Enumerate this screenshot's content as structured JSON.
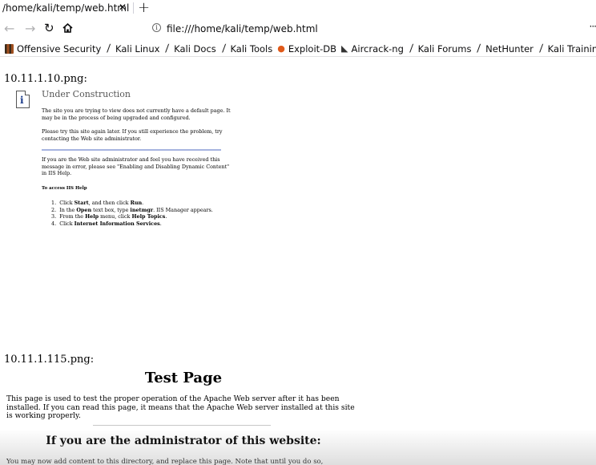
{
  "tab": {
    "title": "/home/kali/temp/web.html",
    "close_glyph": "✕",
    "new_tab_glyph": "+"
  },
  "nav": {
    "back_glyph": "←",
    "forward_glyph": "→",
    "reload_glyph": "↻",
    "home_glyph": "⌂",
    "url": "file:///home/kali/temp/web.html",
    "more_glyph": "···"
  },
  "bookmarks": [
    {
      "label": "Offensive Security",
      "icon": "offsec-icon"
    },
    {
      "label": "Kali Linux",
      "icon": "kali-dragon-icon"
    },
    {
      "label": "Kali Docs",
      "icon": "kali-dragon-icon"
    },
    {
      "label": "Kali Tools",
      "icon": "kali-dragon-icon"
    },
    {
      "label": "Exploit-DB",
      "icon": "exploit-db-icon"
    },
    {
      "label": "Aircrack-ng",
      "icon": "aircrack-icon"
    },
    {
      "label": "Kali Forums",
      "icon": "kali-dragon-icon"
    },
    {
      "label": "NetHunter",
      "icon": "kali-dragon-icon"
    },
    {
      "label": "Kali Training",
      "icon": "kali-dragon-icon"
    }
  ],
  "page": {
    "host1_label": "10.11.1.10.png:",
    "host2_label": "10.11.1.115.png:",
    "iis": {
      "icon_glyph": "i",
      "title": "Under Construction",
      "p1": "The site you are trying to view does not currently have a default page. It may be in the process of being upgraded and configured.",
      "p2": "Please try this site again later. If you still experience the problem, try contacting the Web site administrator.",
      "p3": "If you are the Web site administrator and feel you have received this message in error, please see \"Enabling and Disabling Dynamic Content\" in IIS Help.",
      "subheading": "To access IIS Help",
      "steps": [
        {
          "num": "1.",
          "pre": "Click ",
          "b1": "Start",
          "mid": ", and then click ",
          "b2": "Run",
          "post": "."
        },
        {
          "num": "2.",
          "pre": "In the ",
          "b1": "Open",
          "mid": " text box, type ",
          "b2": "inetmgr",
          "post": ". IIS Manager appears."
        },
        {
          "num": "3.",
          "pre": "From the ",
          "b1": "Help",
          "mid": " menu, click ",
          "b2": "Help Topics",
          "post": "."
        },
        {
          "num": "4.",
          "pre": "Click ",
          "b1": "Internet Information Services",
          "mid": "",
          "b2": "",
          "post": "."
        }
      ]
    },
    "apache": {
      "title": "Test Page",
      "intro": "This page is used to test the proper operation of the Apache Web server after it has been installed. If you can read this page, it means that the Apache Web server installed at this site is working properly.",
      "admin_heading": "If you are the administrator of this website:",
      "admin_text": "You may now add content to this directory, and replace this page. Note that until you do so,"
    }
  }
}
